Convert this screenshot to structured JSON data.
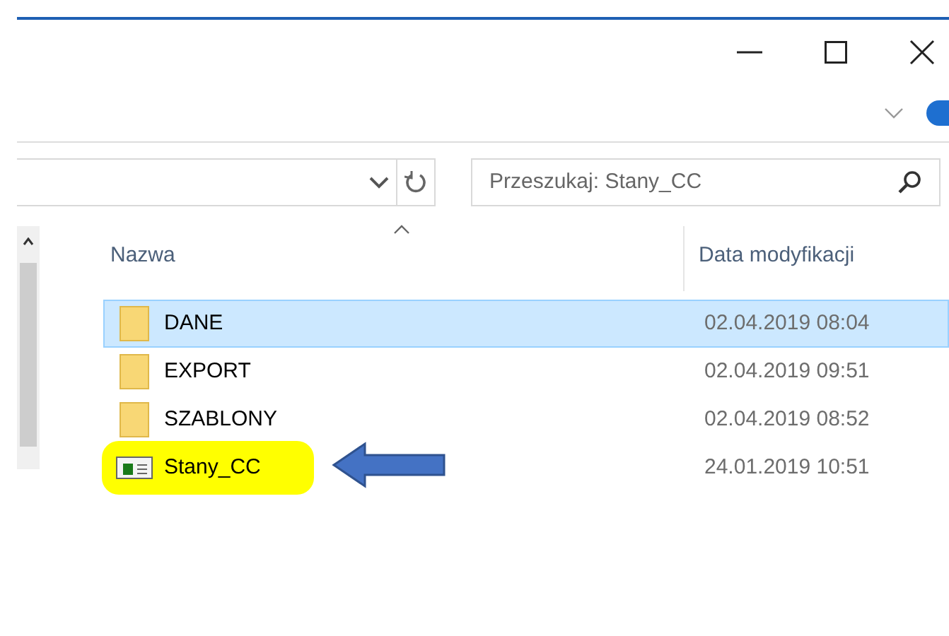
{
  "search": {
    "placeholder": "Przeszukaj: Stany_CC"
  },
  "columns": [
    "Nazwa",
    "Data modyfikacji"
  ],
  "rows": [
    {
      "name": "DANE",
      "date": "02.04.2019 08:04",
      "kind": "folder",
      "selected": true,
      "highlighted": false
    },
    {
      "name": "EXPORT",
      "date": "02.04.2019 09:51",
      "kind": "folder",
      "selected": false,
      "highlighted": false
    },
    {
      "name": "SZABLONY",
      "date": "02.04.2019 08:52",
      "kind": "folder",
      "selected": false,
      "highlighted": false
    },
    {
      "name": "Stany_CC",
      "date": "24.01.2019 10:51",
      "kind": "app",
      "selected": false,
      "highlighted": true
    }
  ]
}
